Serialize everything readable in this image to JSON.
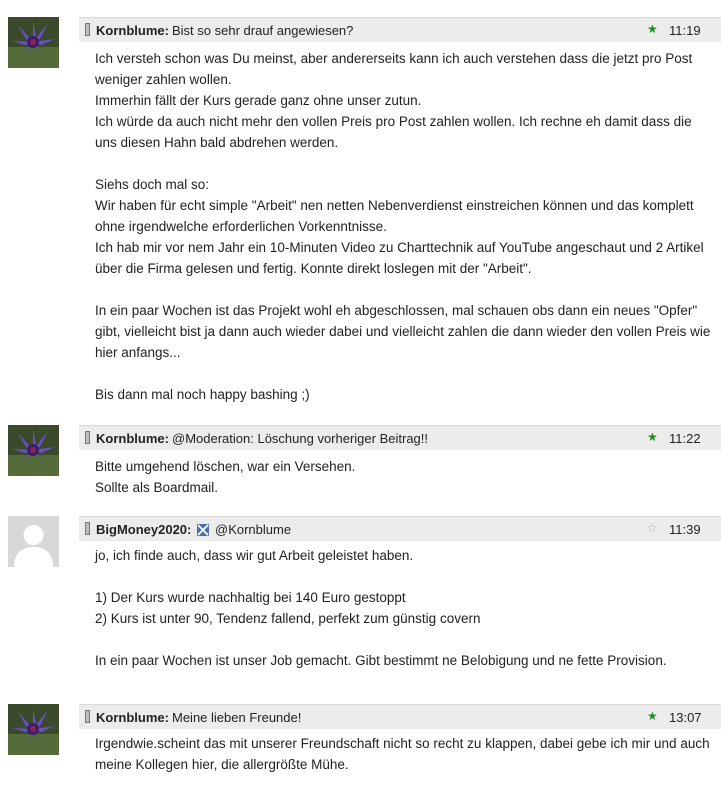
{
  "posts": [
    {
      "author": "Kornblume:",
      "subject": "Bist so sehr drauf angewiesen?",
      "time": "11:19",
      "starred": true,
      "paragraphs": [
        "Ich versteh schon was Du meinst, aber andererseits kann ich auch verstehen dass die jetzt pro Post weniger zahlen wollen.",
        "Immerhin fällt der Kurs gerade ganz ohne unser zutun.",
        "Ich würde da auch nicht mehr den vollen Preis pro Post zahlen wollen. Ich rechne eh damit dass die uns diesen Hahn bald abdrehen werden.",
        "",
        "Siehs doch mal so:",
        "Wir haben für echt simple \"Arbeit\" nen netten Nebenverdienst einstreichen können und das komplett ohne irgendwelche erforderlichen Vorkenntnisse.",
        "Ich hab mir vor nem Jahr ein 10-Minuten Video zu Charttechnik auf YouTube angeschaut und 2 Artikel über die Firma gelesen und fertig. Konnte direkt loslegen mit der \"Arbeit\".",
        "",
        "In ein paar Wochen ist das Projekt wohl eh abgeschlossen, mal schauen obs dann ein neues \"Opfer\" gibt, vielleicht bist ja dann auch wieder dabei und vielleicht zahlen die dann wieder den vollen Preis wie hier anfangs...",
        "",
        "Bis dann mal noch happy bashing ;)"
      ]
    },
    {
      "author": "Kornblume:",
      "subject": "@Moderation: Löschung vorheriger Beitrag!!",
      "time": "11:22",
      "starred": true,
      "paragraphs": [
        "Bitte umgehend löschen, war ein Versehen.",
        "Sollte als Boardmail."
      ]
    },
    {
      "author": "BigMoney2020:",
      "subject": "@Kornblume",
      "time": "11:39",
      "starred": false,
      "paragraphs": [
        "jo, ich finde auch, dass wir gut Arbeit geleistet haben.",
        "",
        "1) Der Kurs wurde nachhaltig bei 140 Euro gestoppt",
        "2) Kurs ist unter 90, Tendenz fallend, perfekt zum günstig covern",
        "",
        "In ein paar Wochen ist unser Job gemacht. Gibt bestimmt ne Belobigung und ne fette Provision."
      ]
    },
    {
      "author": "Kornblume:",
      "subject": "Meine lieben Freunde!",
      "time": "13:07",
      "starred": true,
      "paragraphs": [
        "Irgendwie.scheint das mit unserer Freundschaft nicht so recht zu klappen, dabei gebe ich mir und auch meine Kollegen hier, die allergrößte Mühe."
      ]
    }
  ],
  "icons": {
    "star_filled": "★",
    "star_empty": "☆"
  }
}
